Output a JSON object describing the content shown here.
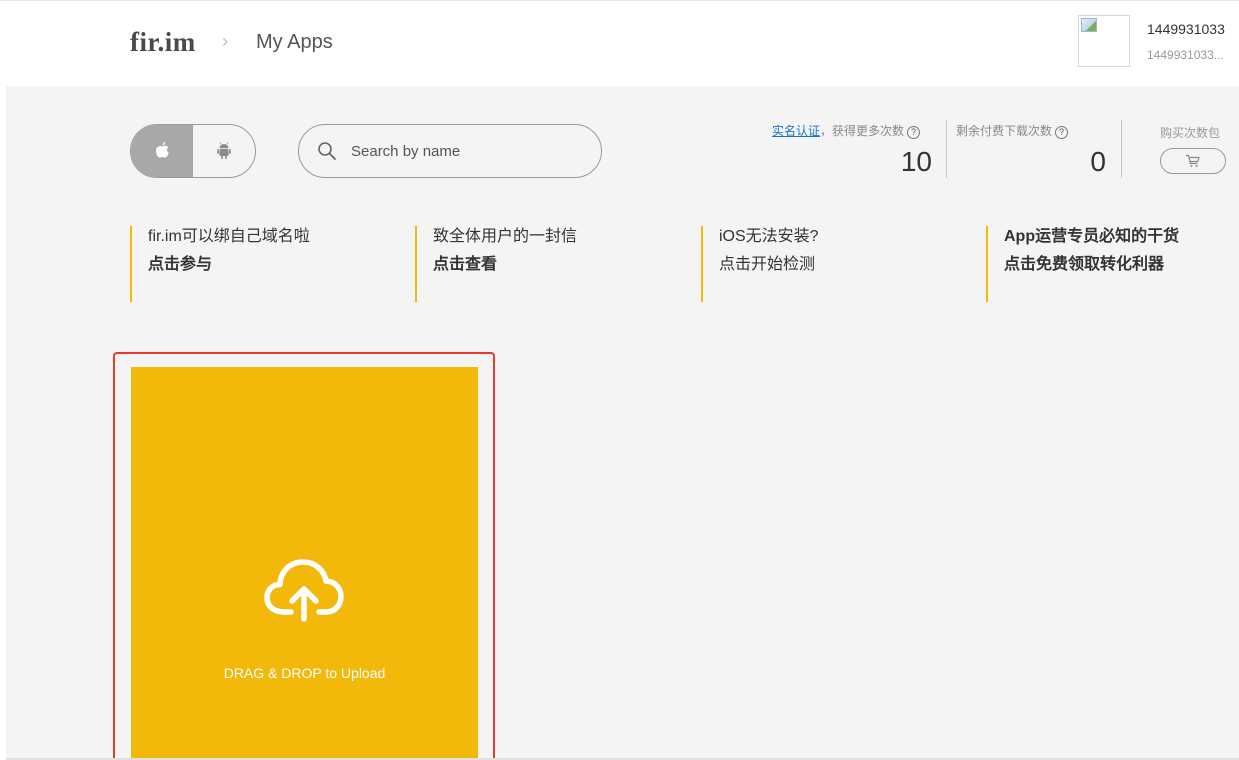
{
  "header": {
    "logo": "fir.im",
    "breadcrumb_separator": "›",
    "breadcrumb": "My Apps",
    "user_name": "1449931033",
    "user_sub": "1449931033..."
  },
  "toolbar": {
    "platforms": [
      "ios",
      "android"
    ],
    "selected_platform": "ios",
    "search_placeholder": "Search by name"
  },
  "stats": {
    "verify_link": "实名认证",
    "verify_suffix": "，获得更多次数",
    "free_count": "10",
    "paid_label": "剩余付费下载次数",
    "paid_count": "0",
    "buy_label": "购买次数包"
  },
  "banners": [
    {
      "line1": "fir.im可以绑自己域名啦",
      "line2": "点击参与"
    },
    {
      "line1": "致全体用户的一封信",
      "line2": "点击查看"
    },
    {
      "line1": "iOS无法安装?",
      "line2": "点击开始检测"
    },
    {
      "line1": "App运营专员必知的干货",
      "line2": "点击免费领取转化利器"
    }
  ],
  "upload": {
    "label": "DRAG & DROP to Upload"
  },
  "colors": {
    "accent": "#f2b80a",
    "highlight_border": "#e53b2f",
    "link": "#1a73c9",
    "background": "#f4f4f4"
  },
  "icons": {
    "ios": "apple-icon",
    "android": "android-icon",
    "search": "search-icon",
    "cart": "cart-icon",
    "upload": "cloud-upload-icon"
  }
}
